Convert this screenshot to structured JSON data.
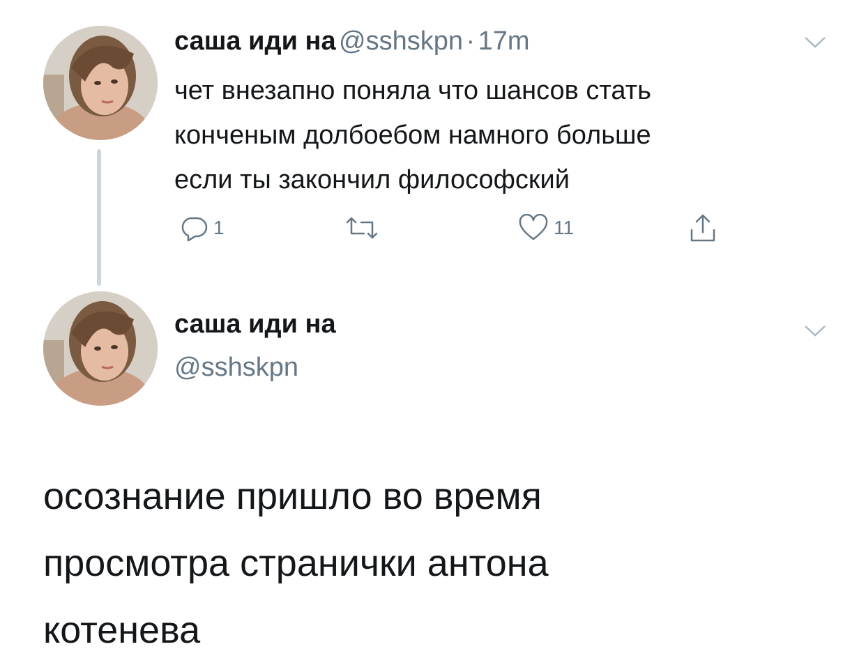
{
  "tweet1": {
    "author_name": "саша иди на",
    "handle": "@sshskpn",
    "separator": "·",
    "time": "17m",
    "text_lines": [
      "чет внезапно поняла что шансов стать",
      "конченым долбоебом намного больше",
      "если ты закончил философский"
    ],
    "actions": {
      "reply_count": "1",
      "retweet_count": "",
      "like_count": "11"
    }
  },
  "tweet2": {
    "author_name": "саша иди на",
    "handle": "@sshskpn",
    "text_lines": [
      "осознание пришло во время",
      "просмотра странички антона",
      "котенева"
    ]
  },
  "icons": {
    "reply": "reply-icon",
    "retweet": "retweet-icon",
    "like": "heart-icon",
    "share": "share-icon",
    "menu": "chevron-down-icon"
  },
  "colors": {
    "text": "#14171a",
    "muted": "#657786",
    "thread_line": "#cbd6dd"
  }
}
